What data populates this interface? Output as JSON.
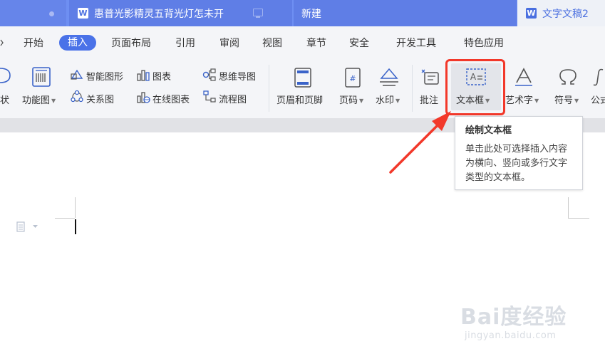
{
  "tabs": {
    "doc_title": "惠普光影精灵五背光灯怎未开",
    "new_tab": "新建",
    "active_tab": "文字文稿2",
    "w_letter": "W"
  },
  "menu": {
    "partial": "​",
    "items": [
      "开始",
      "插入",
      "页面布局",
      "引用",
      "审阅",
      "视图",
      "章节",
      "安全",
      "开发工具",
      "特色应用"
    ],
    "active": "插入"
  },
  "ribbon": {
    "partial_shape": "状",
    "function_chart": "功能图",
    "smart_graphic": "智能图形",
    "chart": "图表",
    "mind_map": "思维导图",
    "relation_chart": "关系图",
    "online_chart": "在线图表",
    "flowchart": "流程图",
    "header_footer": "页眉和页脚",
    "page_number": "页码",
    "watermark": "水印",
    "comment": "批注",
    "text_box": "文本框",
    "art_text": "艺术字",
    "symbol": "符号",
    "formula": "公式"
  },
  "tooltip": {
    "title": "绘制文本框",
    "body": "单击此处可选择插入内容为横向、竖向或多行文字类型的文本框。"
  },
  "watermark": {
    "brand": "Bai度经验",
    "url": "jingyan.baidu.com"
  },
  "colors": {
    "titlebar": "#6e8ff2",
    "accent": "#4a72e8",
    "highlight_border": "#f2382a",
    "arrow": "#f2382a"
  }
}
